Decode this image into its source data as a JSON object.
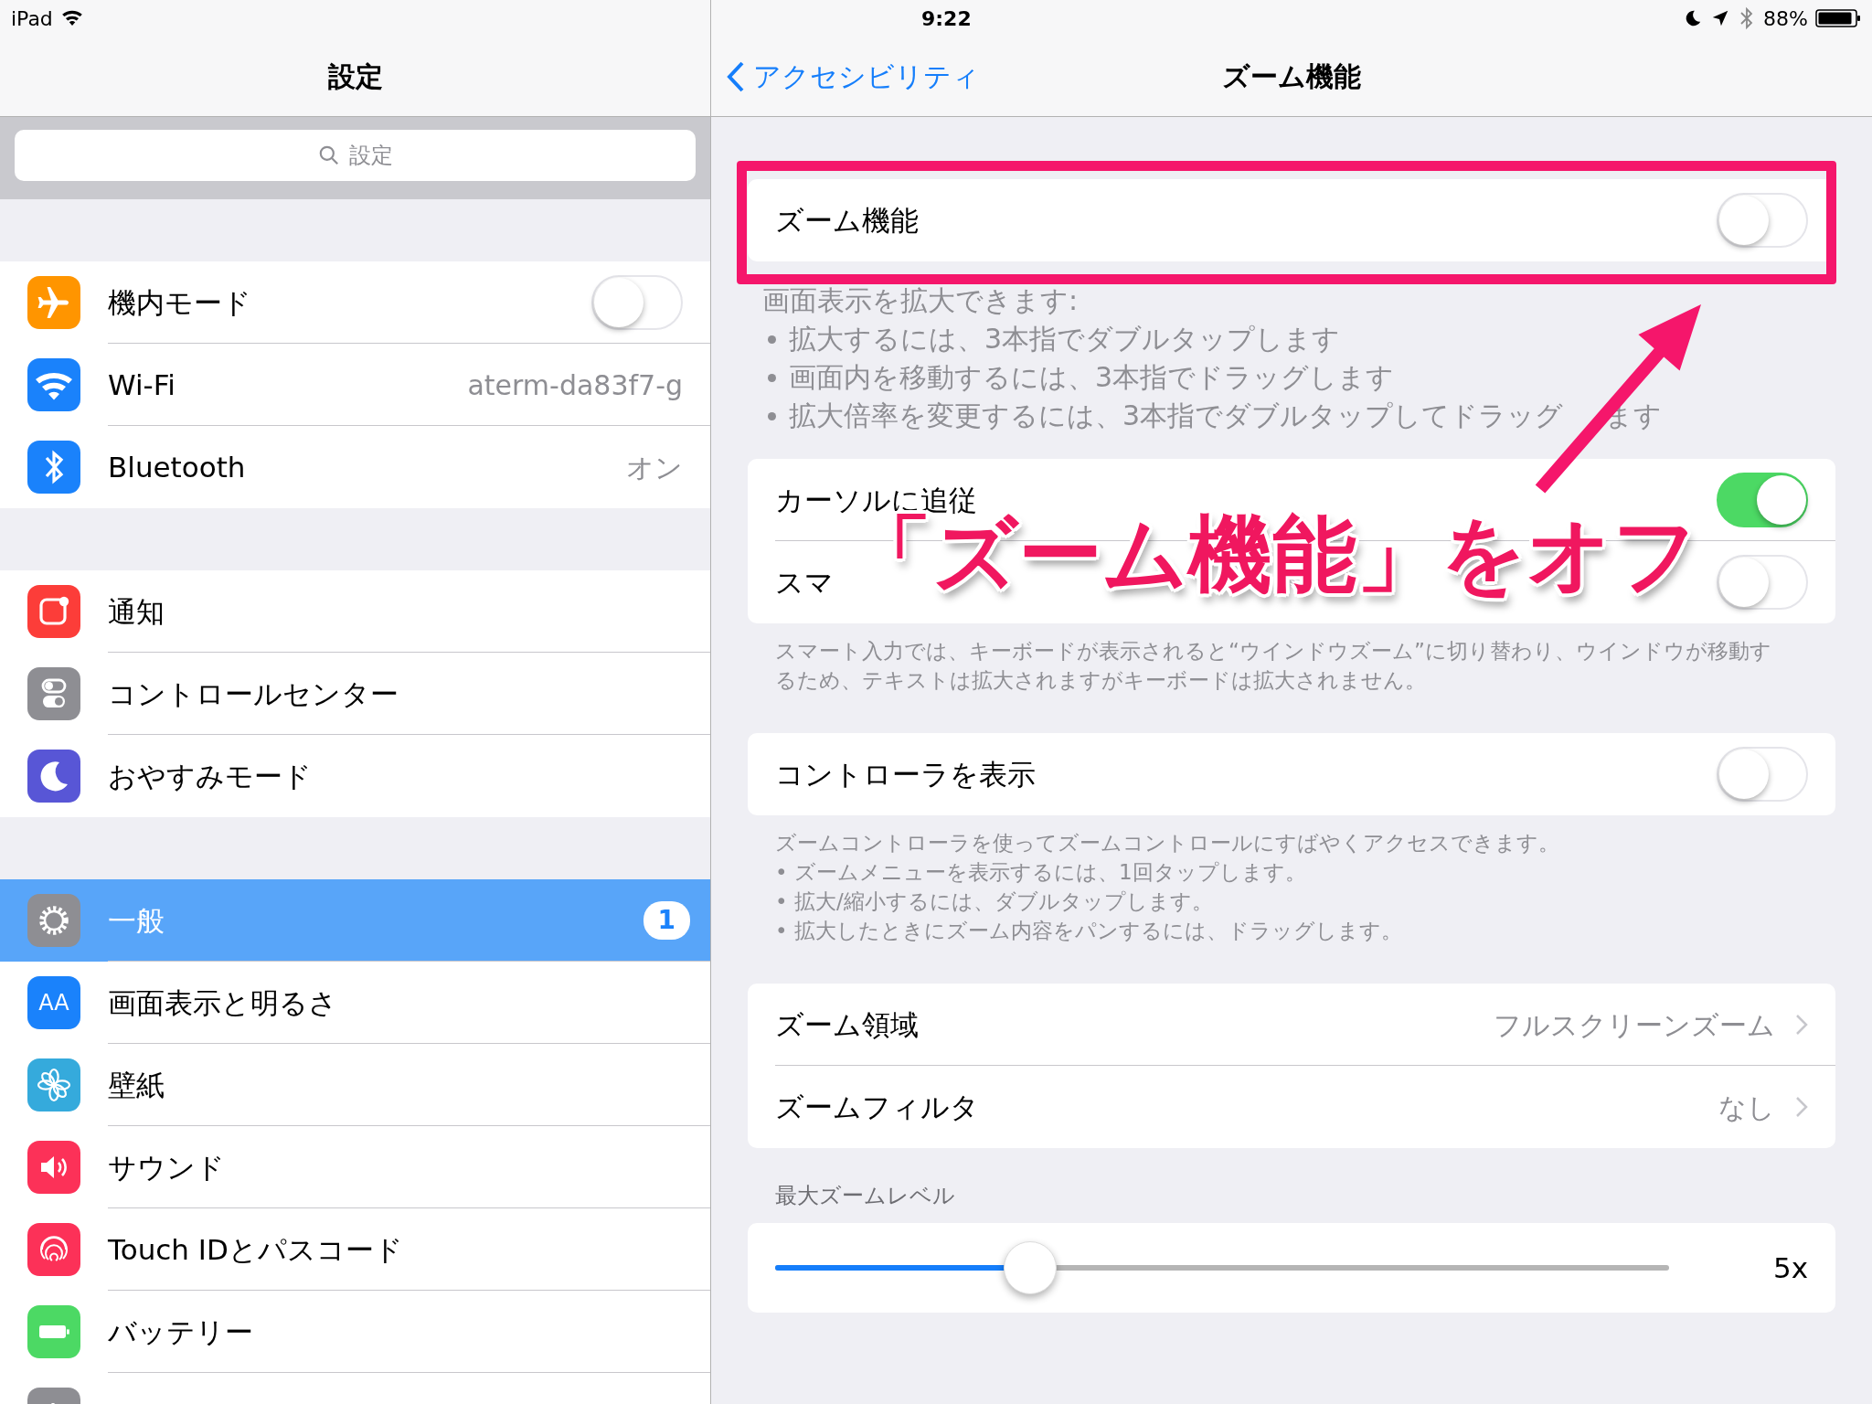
{
  "status_bar": {
    "device": "iPad",
    "time": "9:22",
    "battery": "88%"
  },
  "sidebar": {
    "title": "設定",
    "search": {
      "placeholder": "設定"
    },
    "groups": [
      {
        "items": [
          {
            "label": "機内モード",
            "kind": "toggle",
            "on": false,
            "color": "#ff9500",
            "selected": false
          },
          {
            "label": "Wi-Fi",
            "kind": "detail",
            "value": "aterm-da83f7-g",
            "color": "#1a82fb",
            "selected": false
          },
          {
            "label": "Bluetooth",
            "kind": "detail",
            "value": "オン",
            "color": "#1a82fb",
            "selected": false
          }
        ]
      },
      {
        "items": [
          {
            "label": "通知",
            "kind": "plain",
            "color": "#fc3d39",
            "selected": false
          },
          {
            "label": "コントロールセンター",
            "kind": "plain",
            "color": "#8e8e93",
            "selected": false
          },
          {
            "label": "おやすみモード",
            "kind": "plain",
            "color": "#5856d6",
            "selected": false
          }
        ]
      },
      {
        "items": [
          {
            "label": "一般",
            "kind": "badge",
            "badge": "1",
            "color": "#8e8e93",
            "selected": true
          },
          {
            "label": "画面表示と明るさ",
            "kind": "plain",
            "glyph": "AA",
            "color": "#1a82fb",
            "selected": false
          },
          {
            "label": "壁紙",
            "kind": "plain",
            "color": "#35aadc",
            "selected": false
          },
          {
            "label": "サウンド",
            "kind": "plain",
            "color": "#fc3158",
            "selected": false
          },
          {
            "label": "Touch IDとパスコード",
            "kind": "plain",
            "color": "#fc3158",
            "selected": false
          },
          {
            "label": "バッテリー",
            "kind": "plain",
            "color": "#4cd964",
            "selected": false
          },
          {
            "kind": "plain",
            "color": "#8e8e93",
            "selected": false
          }
        ]
      }
    ]
  },
  "nav": {
    "back": "アクセシビリティ",
    "title": "ズーム機能"
  },
  "sections": [
    {
      "rows": [
        {
          "kind": "toggle",
          "label": "ズーム機能",
          "on": false
        }
      ],
      "footer": {
        "kind": "list",
        "title": "画面表示を拡大できます:",
        "items": [
          "拡大するには、3本指でダブルタップします",
          "画面内を移動するには、3本指でドラッグします",
          [
            "拡大倍率を変更するには、3本指でダブルタップしてドラッグ",
            "ます"
          ]
        ]
      }
    },
    {
      "rows": [
        {
          "kind": "toggle",
          "label": "カーソルに追従",
          "on": true
        },
        {
          "kind": "toggle",
          "label": "スマ",
          "on": false
        }
      ],
      "footer": {
        "kind": "note",
        "lines": [
          "スマート入力では、キーボードが表示されると“ウインドウズーム”に切り替わり、ウインドウが移動す",
          "るため、テキストは拡大されますがキーボードは拡大されません。"
        ]
      }
    },
    {
      "rows": [
        {
          "kind": "toggle",
          "label": "コントローラを表示",
          "on": false
        }
      ],
      "footer": {
        "kind": "note",
        "lines": [
          "ズームコントローラを使ってズームコントロールにすばやくアクセスできます。",
          "• ズームメニューを表示するには、1回タップします。",
          "• 拡大/縮小するには、ダブルタップします。",
          "• 拡大したときにズーム内容をパンするには、ドラッグします。"
        ]
      }
    },
    {
      "rows": [
        {
          "kind": "detail",
          "label": "ズーム領域",
          "value": "フルスクリーンズーム"
        },
        {
          "kind": "detail",
          "label": "ズームフィルタ",
          "value": "なし"
        }
      ]
    },
    {
      "header": "最大ズームレベル",
      "rows": [
        {
          "kind": "slider",
          "level": 0.285,
          "reading": "5x"
        }
      ]
    }
  ],
  "annotation": {
    "label": "「ズーム機能」をオフ"
  }
}
